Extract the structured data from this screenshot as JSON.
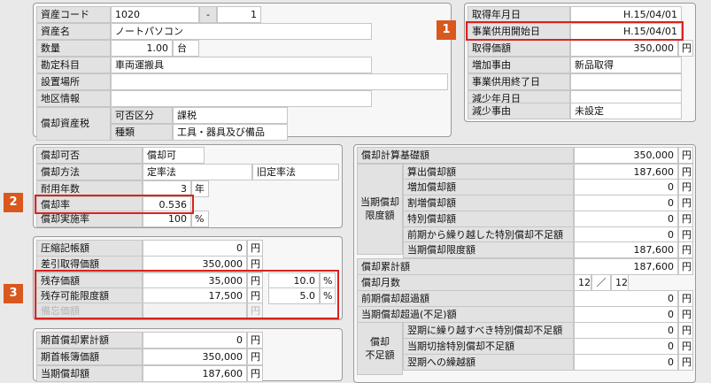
{
  "asset": {
    "code_label": "資産コード",
    "code": "1020",
    "code_sep": "-",
    "code_branch": "1",
    "name_label": "資産名",
    "name": "ノートパソコン",
    "qty_label": "数量",
    "qty": "1.00",
    "qty_unit": "台",
    "account_label": "勘定科目",
    "account": "車両運搬具",
    "location_label": "設置場所",
    "region_label": "地区情報",
    "tax_label": "償却資産税",
    "taxable_label": "可否区分",
    "taxable": "課税",
    "kind_label": "種類",
    "kind": "工具・器具及び備品"
  },
  "dates": {
    "acquired_label": "取得年月日",
    "acquired": "H.15/04/01",
    "start_label": "事業供用開始日",
    "start": "H.15/04/01",
    "cost_label": "取得価額",
    "cost": "350,000",
    "cost_unit": "円",
    "increase_label": "増加事由",
    "increase": "新品取得",
    "end_label": "事業供用終了日",
    "decrease_date_label": "減少年月日",
    "decrease_label": "減少事由",
    "decrease": "未設定"
  },
  "depr": {
    "allow_label": "償却可否",
    "allow": "償却可",
    "method_label": "償却方法",
    "method": "定率法",
    "old_method": "旧定率法",
    "life_label": "耐用年数",
    "life": "3",
    "life_unit": "年",
    "rate_label": "償却率",
    "rate": "0.536",
    "exec_label": "償却実施率",
    "exec": "100",
    "exec_unit": "%"
  },
  "comp": {
    "compress_label": "圧縮記帳額",
    "compress": "0",
    "net_label": "差引取得価額",
    "net": "350,000",
    "residual_label": "残存価額",
    "residual": "35,000",
    "residual_pct": "10.0",
    "limit_label": "残存可能限度額",
    "limit": "17,500",
    "limit_pct": "5.0",
    "memo_label": "備忘価額",
    "yen": "円",
    "pct": "%"
  },
  "bottom": {
    "begin_acc_label": "期首償却累計額",
    "begin_acc": "0",
    "begin_book_label": "期首帳簿価額",
    "begin_book": "350,000",
    "cur_label": "当期償却額",
    "cur": "187,600"
  },
  "right": {
    "base_label": "償却計算基礎額",
    "base": "350,000",
    "group1_label": "当期償却\n限度額",
    "calc_label": "算出償却額",
    "calc": "187,600",
    "add_label": "増加償却額",
    "add": "0",
    "extra_label": "割増償却額",
    "extra": "0",
    "special_label": "特別償却額",
    "special": "0",
    "carry_label": "前期から繰り越した特別償却不足額",
    "carry": "0",
    "limit_label": "当期償却限度額",
    "limit": "187,600",
    "acc_label": "償却累計額",
    "acc": "187,600",
    "months_label": "償却月数",
    "months": "12",
    "months_sep": "／",
    "months_total": "12",
    "over_label": "前期償却超過額",
    "over": "0",
    "over2_label": "当期償却超過(不足)額",
    "over2": "0",
    "group2_label": "償却\n不足額",
    "s1_label": "翌期に繰り越すべき特別償却不足額",
    "s1": "0",
    "s2_label": "当期切捨特別償却不足額",
    "s2": "0",
    "s3_label": "翌期への繰越額",
    "s3": "0",
    "yen": "円"
  },
  "badges": [
    "1",
    "2",
    "3"
  ]
}
